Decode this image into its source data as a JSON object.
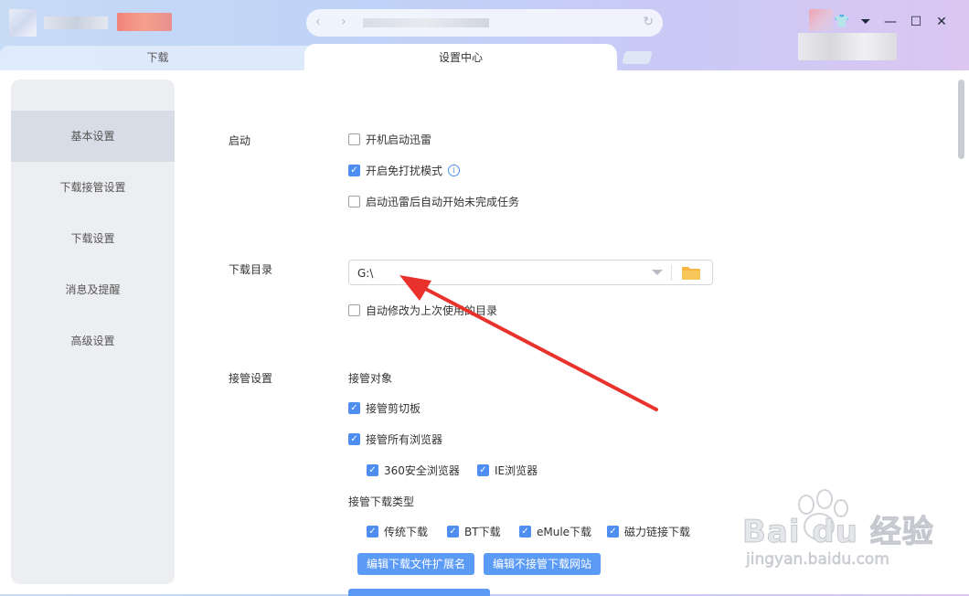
{
  "tabs": {
    "download": "下载",
    "settings": "设置中心"
  },
  "sidebar": {
    "items": [
      {
        "label": "基本设置"
      },
      {
        "label": "下载接管设置"
      },
      {
        "label": "下载设置"
      },
      {
        "label": "消息及提醒"
      },
      {
        "label": "高级设置"
      }
    ]
  },
  "startup": {
    "label": "启动",
    "options": [
      {
        "label": "开机启动迅雷",
        "checked": false
      },
      {
        "label": "开启免打扰模式",
        "checked": true
      },
      {
        "label": "启动迅雷后自动开始未完成任务",
        "checked": false
      }
    ]
  },
  "download_dir": {
    "label": "下载目录",
    "value": "G:\\",
    "auto_modify": {
      "label": "自动修改为上次使用的目录",
      "checked": false
    }
  },
  "takeover": {
    "label": "接管设置",
    "objects_label": "接管对象",
    "clipboard": {
      "label": "接管剪切板",
      "checked": true
    },
    "all_browsers": {
      "label": "接管所有浏览器",
      "checked": true
    },
    "browsers": [
      {
        "label": "360安全浏览器",
        "checked": true
      },
      {
        "label": "IE浏览器",
        "checked": true
      }
    ],
    "types_label": "接管下载类型",
    "types": [
      {
        "label": "传统下载",
        "checked": true
      },
      {
        "label": "BT下载",
        "checked": true
      },
      {
        "label": "eMule下载",
        "checked": true
      },
      {
        "label": "磁力链接下载",
        "checked": true
      }
    ],
    "edit_ext_button": "编辑下载文件扩展名",
    "edit_sites_button": "编辑不接管下载网站"
  },
  "watermark": {
    "brand": "Bai du 经验",
    "url": "jingyan.baidu.com"
  },
  "colors": {
    "accent": "#4d8ef0",
    "button": "#5b9bf5",
    "arrow": "#e8322b"
  }
}
